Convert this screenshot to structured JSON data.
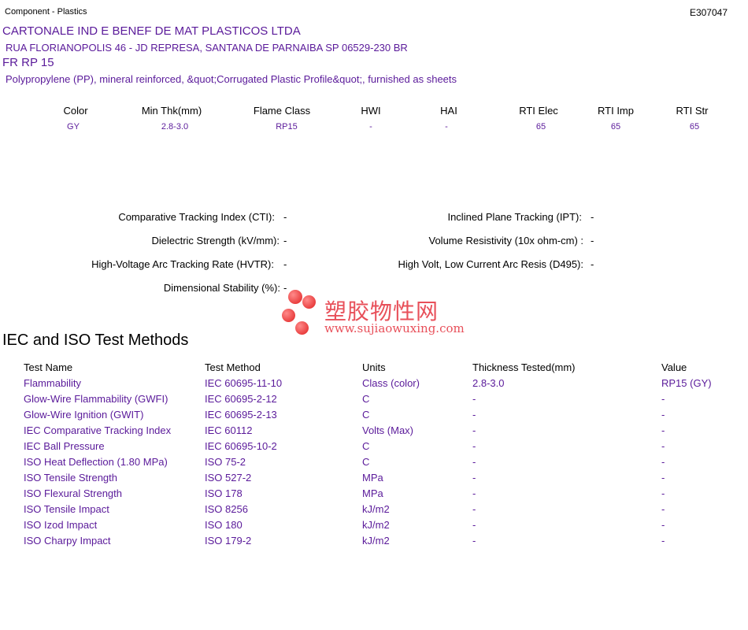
{
  "header": {
    "category": "Component - Plastics",
    "file_number": "E307047"
  },
  "company": {
    "name": "CARTONALE IND E BENEF DE MAT PLASTICOS LTDA",
    "address": "RUA FLORIANOPOLIS 46 - JD REPRESA, SANTANA DE PARNAIBA SP   06529-230 BR"
  },
  "grade": "FR RP 15",
  "description": "Polypropylene (PP), mineral reinforced, &quot;Corrugated Plastic Profile&quot;, furnished as sheets",
  "properties": {
    "headers": [
      "Color",
      "Min Thk(mm)",
      "Flame Class",
      "HWI",
      "HAI",
      "RTI Elec",
      "RTI Imp",
      "RTI Str"
    ],
    "values": [
      "GY",
      "2.8-3.0",
      "RP15",
      "-",
      "-",
      "65",
      "65",
      "65"
    ]
  },
  "electrical": {
    "left": [
      {
        "label": "Comparative Tracking Index (CTI):",
        "value": "-"
      },
      {
        "label": "Dielectric Strength (kV/mm):",
        "value": "-"
      },
      {
        "label": "High-Voltage Arc Tracking Rate (HVTR):",
        "value": "-"
      },
      {
        "label": "Dimensional Stability (%):",
        "value": "-"
      }
    ],
    "right": [
      {
        "label": "Inclined Plane Tracking (IPT):",
        "value": "-"
      },
      {
        "label": "Volume Resistivity (10x ohm-cm) :",
        "value": "-"
      },
      {
        "label": "High Volt, Low Current Arc Resis (D495):",
        "value": "-"
      }
    ]
  },
  "section_title": "IEC and ISO Test Methods",
  "test_methods": {
    "headers": [
      "Test Name",
      "Test Method",
      "Units",
      "Thickness Tested(mm)",
      "Value"
    ],
    "rows": [
      [
        "Flammability",
        "IEC 60695-11-10",
        "Class (color)",
        "2.8-3.0",
        "RP15 (GY)"
      ],
      [
        "Glow-Wire Flammability (GWFI)",
        "IEC 60695-2-12",
        "C",
        "-",
        "-"
      ],
      [
        "Glow-Wire Ignition (GWIT)",
        "IEC 60695-2-13",
        "C",
        "-",
        "-"
      ],
      [
        "IEC Comparative Tracking Index",
        "IEC 60112",
        "Volts (Max)",
        "-",
        "-"
      ],
      [
        "IEC Ball Pressure",
        "IEC 60695-10-2",
        "C",
        "-",
        "-"
      ],
      [
        "ISO Heat Deflection (1.80 MPa)",
        "ISO 75-2",
        "C",
        "-",
        "-"
      ],
      [
        "ISO Tensile Strength",
        "ISO 527-2",
        "MPa",
        "-",
        "-"
      ],
      [
        "ISO Flexural Strength",
        "ISO 178",
        "MPa",
        "-",
        "-"
      ],
      [
        "ISO Tensile Impact",
        "ISO 8256",
        "kJ/m2",
        "-",
        "-"
      ],
      [
        "ISO Izod Impact",
        "ISO 180",
        "kJ/m2",
        "-",
        "-"
      ],
      [
        "ISO Charpy Impact",
        "ISO 179-2",
        "kJ/m2",
        "-",
        "-"
      ]
    ]
  },
  "watermark": {
    "name": "塑胶物性网",
    "url": "www.sujiaowuxing.com"
  },
  "colors": {
    "accent": "#5a1a9a",
    "watermark": "#e8505a"
  }
}
